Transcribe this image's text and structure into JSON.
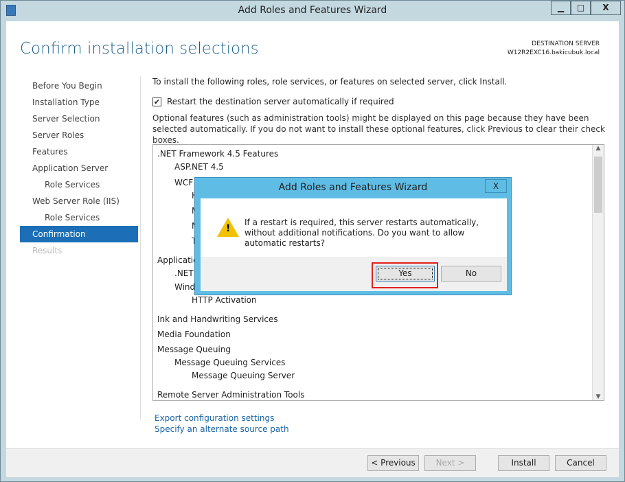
{
  "window": {
    "title": "Add Roles and Features Wizard",
    "minimize": "▁",
    "maximize": "□",
    "close": "X"
  },
  "page_title": "Confirm installation selections",
  "destination": {
    "label": "DESTINATION SERVER",
    "server": "W12R2EXC16.bakicubuk.local"
  },
  "nav": [
    {
      "label": "Before You Begin"
    },
    {
      "label": "Installation Type"
    },
    {
      "label": "Server Selection"
    },
    {
      "label": "Server Roles"
    },
    {
      "label": "Features"
    },
    {
      "label": "Application Server"
    },
    {
      "label": "Role Services"
    },
    {
      "label": "Web Server Role (IIS)"
    },
    {
      "label": "Role Services"
    },
    {
      "label": "Confirmation"
    },
    {
      "label": "Results"
    }
  ],
  "intro": "To install the following roles, role services, or features on selected server, click Install.",
  "restart_checkbox": {
    "label": "Restart the destination server automatically if required",
    "checked": true
  },
  "note": "Optional features (such as administration tools) might be displayed on this page because they have been selected automatically. If you do not want to install these optional features, click Previous to clear their check boxes.",
  "items": [
    ".NET Framework 4.5 Features",
    "ASP.NET 4.5",
    "WCF S",
    "H",
    "M",
    "N",
    "T",
    "Application",
    "​.NET F",
    "Windo",
    "HTTP Activation",
    "Ink and Handwriting Services",
    "Media Foundation",
    "Message Queuing",
    "Message Queuing Services",
    "Message Queuing Server",
    "Remote Server Administration Tools"
  ],
  "links": {
    "export": "Export configuration settings",
    "alt_source": "Specify an alternate source path"
  },
  "buttons": {
    "previous": "< Previous",
    "next": "Next >",
    "install": "Install",
    "cancel": "Cancel"
  },
  "dialog": {
    "title": "Add Roles and Features Wizard",
    "close": "X",
    "message": "If a restart is required, this server restarts automatically, without additional notifications. Do you want to allow automatic restarts?",
    "yes": "Yes",
    "no": "No",
    "highlight_color": "#e0201c"
  }
}
